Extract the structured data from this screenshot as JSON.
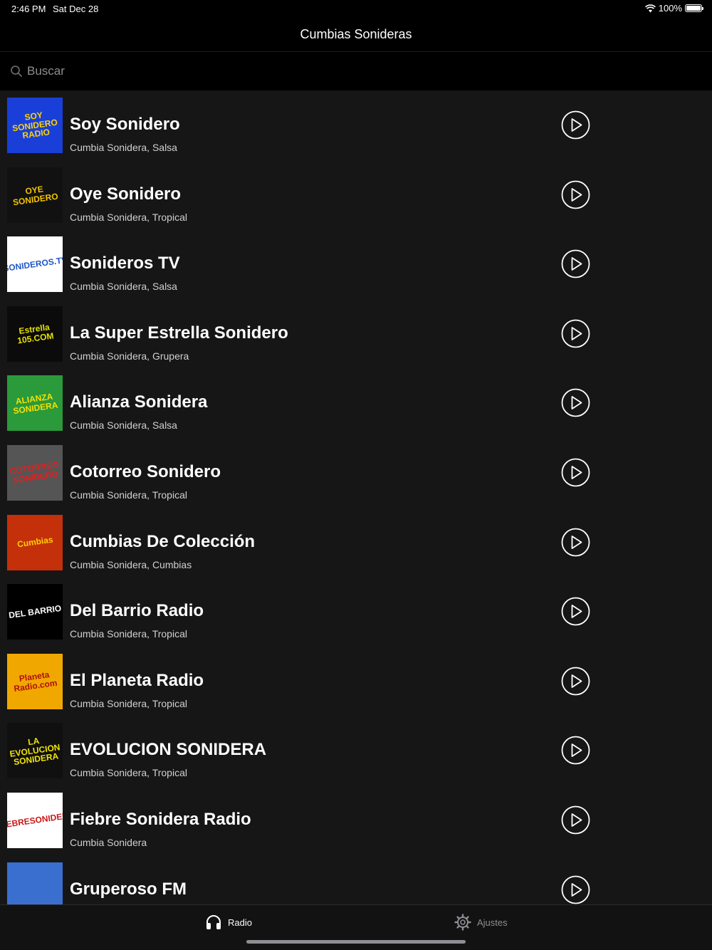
{
  "status_bar": {
    "time": "2:46 PM",
    "date": "Sat Dec 28",
    "battery": "100%"
  },
  "nav": {
    "title": "Cumbias Sonideras"
  },
  "search": {
    "placeholder": "Buscar"
  },
  "stations": [
    {
      "name": "Soy Sonidero",
      "genre": "Cumbia Sonidera, Salsa",
      "logo_text": "SOY SONIDERO RADIO",
      "logo_bg": "#1a3fd8",
      "logo_fg": "#ffd400"
    },
    {
      "name": "Oye Sonidero",
      "genre": "Cumbia Sonidera, Tropical",
      "logo_text": "OYE SONIDERO",
      "logo_bg": "#111111",
      "logo_fg": "#f5c400"
    },
    {
      "name": "Sonideros TV",
      "genre": "Cumbia Sonidera, Salsa",
      "logo_text": "SONIDEROS.TV",
      "logo_bg": "#ffffff",
      "logo_fg": "#1f56c6"
    },
    {
      "name": "La Super Estrella Sonidero",
      "genre": "Cumbia Sonidera, Grupera",
      "logo_text": "Estrella 105.COM",
      "logo_bg": "#0b0b0b",
      "logo_fg": "#e8e000"
    },
    {
      "name": "Alianza Sonidera",
      "genre": "Cumbia Sonidera, Salsa",
      "logo_text": "ALIANZA SONIDERA",
      "logo_bg": "#2a9a3a",
      "logo_fg": "#f7e000"
    },
    {
      "name": "Cotorreo Sonidero",
      "genre": "Cumbia Sonidera, Tropical",
      "logo_text": "COTORREO SONIDERO",
      "logo_bg": "#555555",
      "logo_fg": "#e02020"
    },
    {
      "name": "Cumbias De Colección",
      "genre": "Cumbia Sonidera, Cumbias",
      "logo_text": "Cumbias",
      "logo_bg": "#c4300a",
      "logo_fg": "#ffd000"
    },
    {
      "name": "Del Barrio Radio",
      "genre": "Cumbia Sonidera, Tropical",
      "logo_text": "DEL BARRIO",
      "logo_bg": "#000000",
      "logo_fg": "#ffffff"
    },
    {
      "name": "El Planeta Radio",
      "genre": "Cumbia Sonidera, Tropical",
      "logo_text": "Planeta Radio.com",
      "logo_bg": "#f0a800",
      "logo_fg": "#b01010"
    },
    {
      "name": "EVOLUCION SONIDERA",
      "genre": "Cumbia Sonidera, Tropical",
      "logo_text": "LA EVOLUCION SONIDERA",
      "logo_bg": "#101010",
      "logo_fg": "#f2e600"
    },
    {
      "name": "Fiebre Sonidera Radio",
      "genre": "Cumbia Sonidera",
      "logo_text": "WWW.FIEBRESONIDERA.COM",
      "logo_bg": "#ffffff",
      "logo_fg": "#c81818"
    },
    {
      "name": "Gruperoso FM",
      "genre": "",
      "logo_text": "",
      "logo_bg": "#3a6fd0",
      "logo_fg": "#ffffff"
    }
  ],
  "tabs": [
    {
      "label": "Radio",
      "icon": "headphones-icon",
      "active": true
    },
    {
      "label": "Ajustes",
      "icon": "gear-icon",
      "active": false
    }
  ],
  "colors": {
    "background": "#000000",
    "list_background": "#161616",
    "inactive": "#8e8e93"
  }
}
